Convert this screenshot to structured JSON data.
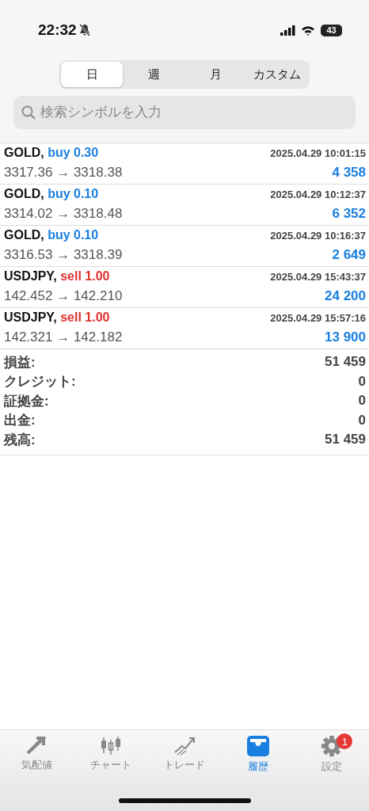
{
  "status_bar": {
    "time": "22:32",
    "battery": "43"
  },
  "period_tabs": [
    {
      "label": "日",
      "selected": true
    },
    {
      "label": "週",
      "selected": false
    },
    {
      "label": "月",
      "selected": false
    },
    {
      "label": "カスタム",
      "selected": false
    }
  ],
  "search": {
    "placeholder": "検索シンボルを入力"
  },
  "trades": [
    {
      "symbol": "GOLD,",
      "kind": "buy",
      "order": "buy 0.30",
      "prices": "3317.36 → 3318.38",
      "time": "2025.04.29 10:01:15",
      "profit": "4 358"
    },
    {
      "symbol": "GOLD,",
      "kind": "buy",
      "order": "buy 0.10",
      "prices": "3314.02 → 3318.48",
      "time": "2025.04.29 10:12:37",
      "profit": "6 352"
    },
    {
      "symbol": "GOLD,",
      "kind": "buy",
      "order": "buy 0.10",
      "prices": "3316.53 → 3318.39",
      "time": "2025.04.29 10:16:37",
      "profit": "2 649"
    },
    {
      "symbol": "USDJPY,",
      "kind": "sell",
      "order": "sell 1.00",
      "prices": "142.452 → 142.210",
      "time": "2025.04.29 15:43:37",
      "profit": "24 200"
    },
    {
      "symbol": "USDJPY,",
      "kind": "sell",
      "order": "sell 1.00",
      "prices": "142.321 → 142.182",
      "time": "2025.04.29 15:57:16",
      "profit": "13 900"
    }
  ],
  "summary": [
    {
      "label": "損益:",
      "value": "51 459"
    },
    {
      "label": "クレジット:",
      "value": "0"
    },
    {
      "label": "証拠金:",
      "value": "0"
    },
    {
      "label": "出金:",
      "value": "0"
    },
    {
      "label": "残高:",
      "value": "51 459"
    }
  ],
  "tab_bar": [
    {
      "kind": "quotes",
      "label": "気配値",
      "selected": false
    },
    {
      "kind": "chart",
      "label": "チャート",
      "selected": false
    },
    {
      "kind": "trade",
      "label": "トレード",
      "selected": false
    },
    {
      "kind": "history",
      "label": "履歴",
      "selected": true
    },
    {
      "kind": "settings",
      "label": "設定",
      "selected": false,
      "badge": "1"
    }
  ]
}
